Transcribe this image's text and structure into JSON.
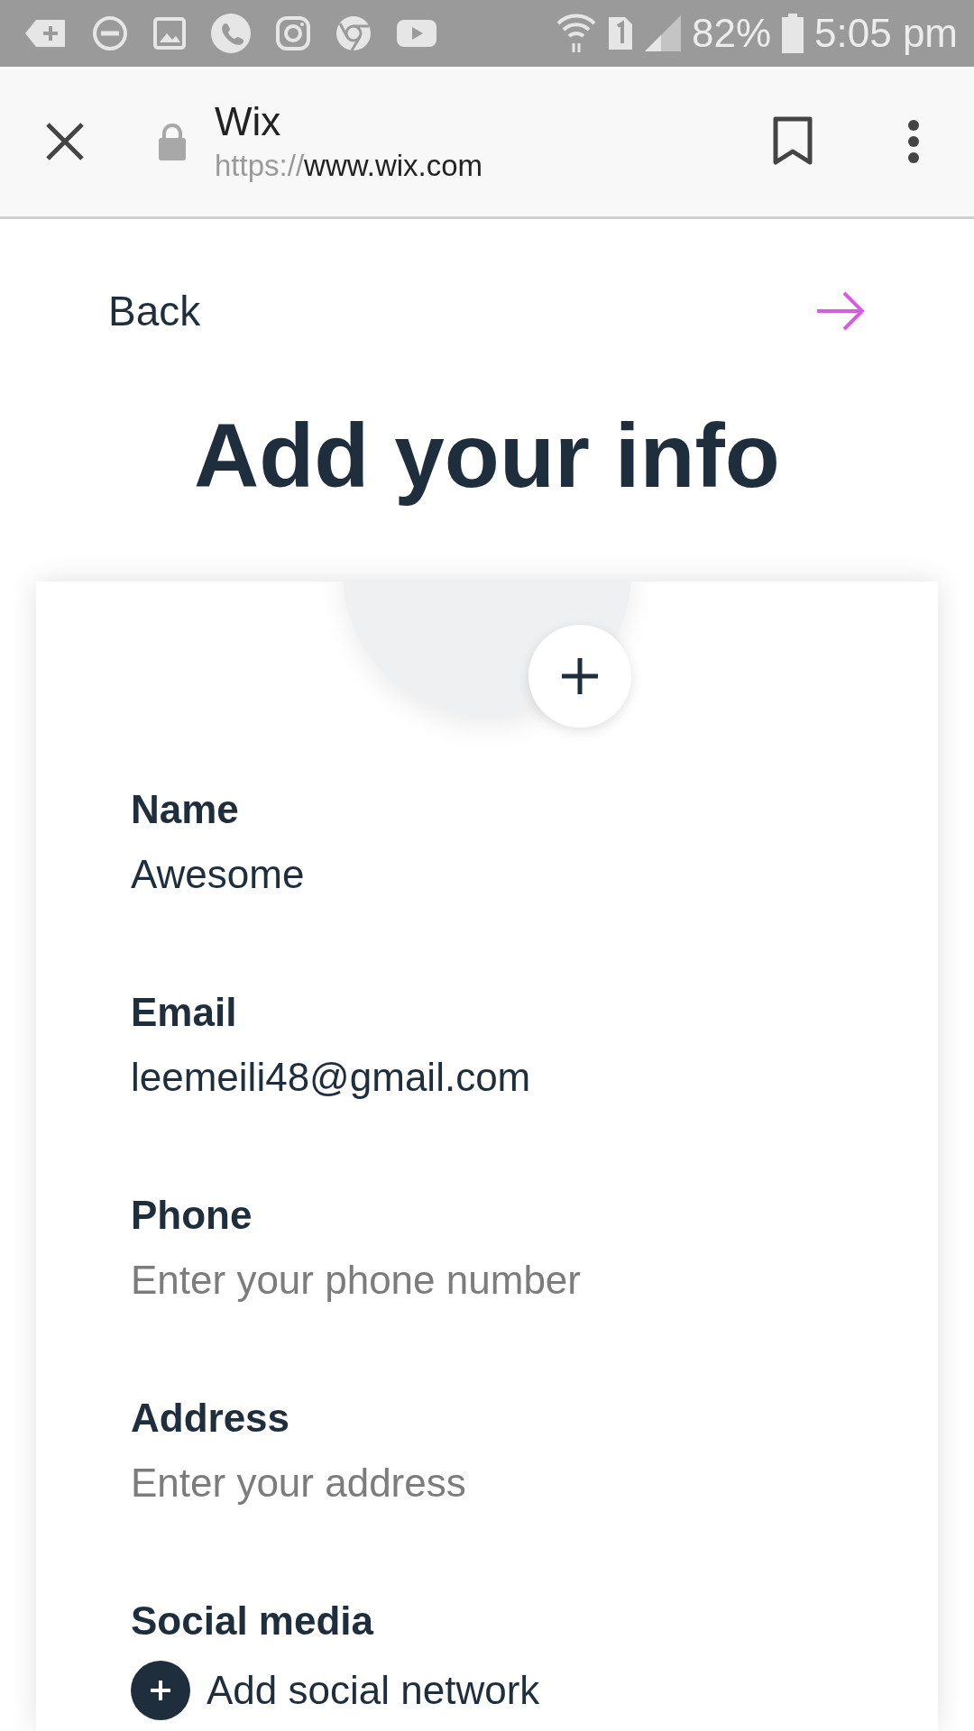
{
  "status_bar": {
    "battery": "82%",
    "time": "5:05 pm"
  },
  "browser": {
    "title": "Wix",
    "url_scheme": "https://",
    "url_host": "www.wix.com"
  },
  "nav": {
    "back": "Back"
  },
  "heading": "Add your info",
  "fields": [
    {
      "label": "Name",
      "value": "Awesome"
    },
    {
      "label": "Email",
      "value": "leemeili48@gmail.com"
    },
    {
      "label": "Phone",
      "placeholder": "Enter your phone number"
    },
    {
      "label": "Address",
      "placeholder": "Enter your address"
    }
  ],
  "social": {
    "label": "Social media",
    "action": "Add social network"
  }
}
